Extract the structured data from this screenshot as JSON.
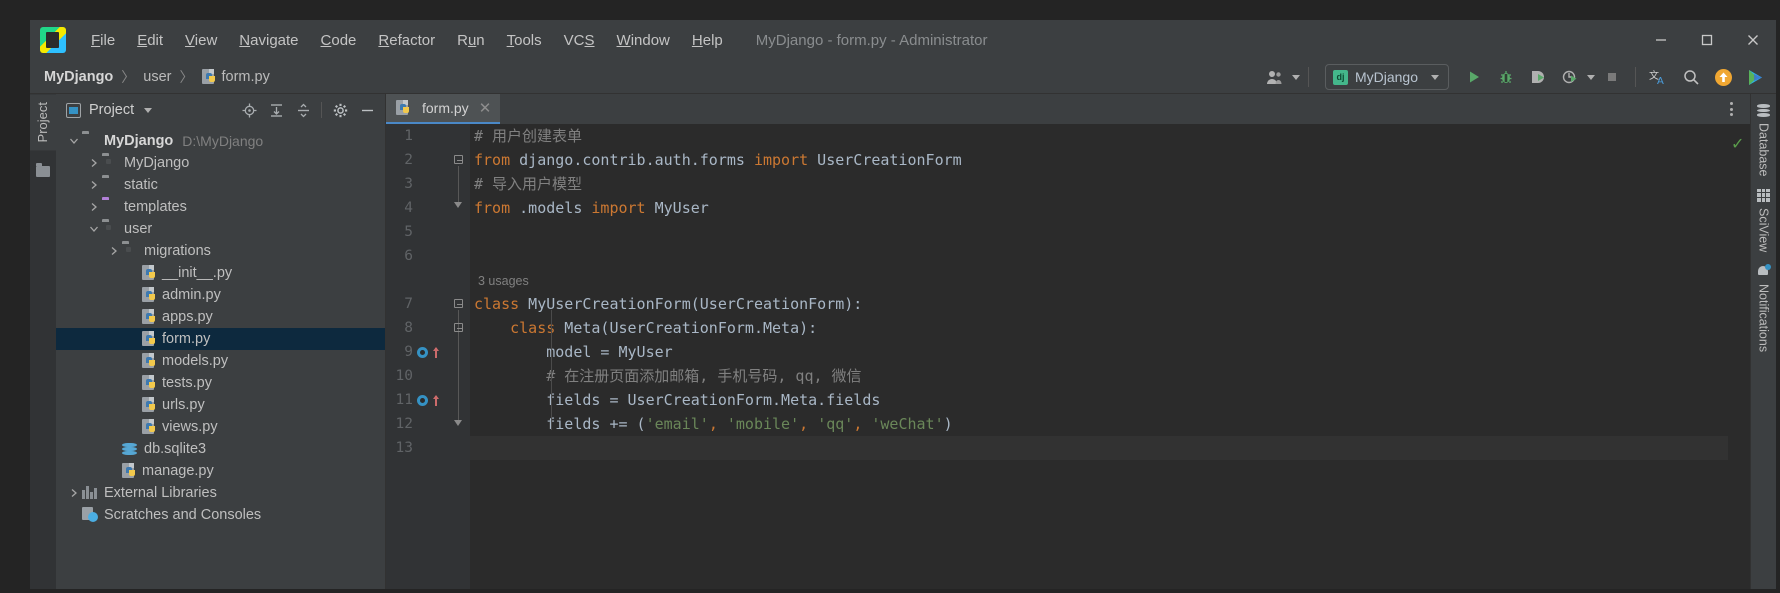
{
  "window": {
    "title": "MyDjango - form.py - Administrator",
    "minimize_icon": "minimize-icon",
    "maximize_icon": "maximize-icon",
    "close_icon": "close-icon"
  },
  "menubar": {
    "logo_label": "PC",
    "items": [
      {
        "label": "File",
        "mnemonic": "F"
      },
      {
        "label": "Edit",
        "mnemonic": "E"
      },
      {
        "label": "View",
        "mnemonic": "V"
      },
      {
        "label": "Navigate",
        "mnemonic": "N"
      },
      {
        "label": "Code",
        "mnemonic": "C"
      },
      {
        "label": "Refactor",
        "mnemonic": "R"
      },
      {
        "label": "Run",
        "mnemonic": "u"
      },
      {
        "label": "Tools",
        "mnemonic": "T"
      },
      {
        "label": "VCS",
        "mnemonic": "S"
      },
      {
        "label": "Window",
        "mnemonic": "W"
      },
      {
        "label": "Help",
        "mnemonic": "H"
      }
    ]
  },
  "breadcrumb": {
    "items": [
      "MyDjango",
      "user",
      "form.py"
    ],
    "separator": "〉",
    "file_icon": "python-file-icon"
  },
  "toolbar": {
    "account_icon": "user-account-icon",
    "run_config_name": "MyDjango",
    "run_config_icon": "django-icon",
    "run_icon": "run-icon",
    "debug_icon": "debug-icon",
    "coverage_icon": "run-with-coverage-icon",
    "profile_icon": "profiler-icon",
    "stop_icon": "stop-icon",
    "translate_icon": "translate-icon",
    "search_icon": "search-icon",
    "update_icon": "update-project-icon",
    "plugin_icon": "plugin-icon"
  },
  "project_panel": {
    "title": "Project",
    "vertical_tab": "Project",
    "locate_icon": "locate-in-tree-icon",
    "expand_icon": "expand-all-icon",
    "collapse_icon": "collapse-all-icon",
    "settings_icon": "gear-icon",
    "hide_icon": "hide-panel-icon",
    "tree": [
      {
        "label": "MyDjango",
        "path": "D:\\MyDjango",
        "icon": "folder-icon",
        "indent": 0,
        "arrow": "down",
        "bold": true,
        "selected": false
      },
      {
        "label": "MyDjango",
        "path": "",
        "icon": "module-folder-icon",
        "indent": 1,
        "arrow": "right",
        "bold": false,
        "selected": false
      },
      {
        "label": "static",
        "path": "",
        "icon": "folder-icon",
        "indent": 1,
        "arrow": "right",
        "bold": false,
        "selected": false
      },
      {
        "label": "templates",
        "path": "",
        "icon": "templates-folder-icon",
        "indent": 1,
        "arrow": "right",
        "bold": false,
        "selected": false
      },
      {
        "label": "user",
        "path": "",
        "icon": "module-folder-icon",
        "indent": 1,
        "arrow": "down",
        "bold": false,
        "selected": false
      },
      {
        "label": "migrations",
        "path": "",
        "icon": "module-folder-icon",
        "indent": 2,
        "arrow": "right",
        "bold": false,
        "selected": false
      },
      {
        "label": "__init__.py",
        "path": "",
        "icon": "python-file-icon",
        "indent": 3,
        "arrow": "none",
        "bold": false,
        "selected": false
      },
      {
        "label": "admin.py",
        "path": "",
        "icon": "python-file-icon",
        "indent": 3,
        "arrow": "none",
        "bold": false,
        "selected": false
      },
      {
        "label": "apps.py",
        "path": "",
        "icon": "python-file-icon",
        "indent": 3,
        "arrow": "none",
        "bold": false,
        "selected": false
      },
      {
        "label": "form.py",
        "path": "",
        "icon": "python-file-icon",
        "indent": 3,
        "arrow": "none",
        "bold": false,
        "selected": true
      },
      {
        "label": "models.py",
        "path": "",
        "icon": "python-file-icon",
        "indent": 3,
        "arrow": "none",
        "bold": false,
        "selected": false
      },
      {
        "label": "tests.py",
        "path": "",
        "icon": "python-file-icon",
        "indent": 3,
        "arrow": "none",
        "bold": false,
        "selected": false
      },
      {
        "label": "urls.py",
        "path": "",
        "icon": "python-file-icon",
        "indent": 3,
        "arrow": "none",
        "bold": false,
        "selected": false
      },
      {
        "label": "views.py",
        "path": "",
        "icon": "python-file-icon",
        "indent": 3,
        "arrow": "none",
        "bold": false,
        "selected": false
      },
      {
        "label": "db.sqlite3",
        "path": "",
        "icon": "database-file-icon",
        "indent": 2,
        "arrow": "none",
        "bold": false,
        "selected": false
      },
      {
        "label": "manage.py",
        "path": "",
        "icon": "python-file-icon",
        "indent": 2,
        "arrow": "none",
        "bold": false,
        "selected": false
      },
      {
        "label": "External Libraries",
        "path": "",
        "icon": "libraries-icon",
        "indent": 0,
        "arrow": "right",
        "bold": false,
        "selected": false
      },
      {
        "label": "Scratches and Consoles",
        "path": "",
        "icon": "scratches-icon",
        "indent": 0,
        "arrow": "none",
        "bold": false,
        "selected": false
      }
    ]
  },
  "editor": {
    "tab": {
      "label": "form.py",
      "icon": "python-file-icon",
      "close_icon": "close-icon"
    },
    "options_icon": "more-options-icon",
    "inspection_status": "ok-check-icon",
    "usage_hint": "3 usages",
    "lines": [
      {
        "no": "1",
        "tokens": [
          {
            "t": "# 用户创建表单",
            "c": "cm"
          }
        ],
        "indent": 0
      },
      {
        "no": "2",
        "tokens": [
          {
            "t": "from",
            "c": "kw"
          },
          {
            "t": " django.contrib.auth.forms ",
            "c": "cls"
          },
          {
            "t": "import",
            "c": "kw"
          },
          {
            "t": " UserCreationForm",
            "c": "cls"
          }
        ],
        "indent": 0
      },
      {
        "no": "3",
        "tokens": [
          {
            "t": "# 导入用户模型",
            "c": "cm"
          }
        ],
        "indent": 0
      },
      {
        "no": "4",
        "tokens": [
          {
            "t": "from",
            "c": "kw"
          },
          {
            "t": " .models ",
            "c": "cls"
          },
          {
            "t": "import",
            "c": "kw"
          },
          {
            "t": " MyUser",
            "c": "cls"
          }
        ],
        "indent": 0
      },
      {
        "no": "5",
        "tokens": [],
        "indent": 0
      },
      {
        "no": "6",
        "tokens": [],
        "indent": 0
      },
      {
        "no": "7",
        "tokens": [
          {
            "t": "class",
            "c": "kw"
          },
          {
            "t": " MyUserCreationForm(UserCreationForm):",
            "c": "cls"
          }
        ],
        "indent": 0
      },
      {
        "no": "8",
        "tokens": [
          {
            "t": "    ",
            "c": "cls"
          },
          {
            "t": "class",
            "c": "kw"
          },
          {
            "t": " Meta(UserCreationForm.Meta):",
            "c": "cls"
          }
        ],
        "indent": 1
      },
      {
        "no": "9",
        "tokens": [
          {
            "t": "        model = MyUser",
            "c": "cls"
          }
        ],
        "indent": 2
      },
      {
        "no": "10",
        "tokens": [
          {
            "t": "        # 在注册页面添加邮箱, 手机号码, qq, 微信",
            "c": "cm"
          }
        ],
        "indent": 2
      },
      {
        "no": "11",
        "tokens": [
          {
            "t": "        fields = UserCreationForm.Meta.fields",
            "c": "cls"
          }
        ],
        "indent": 2
      },
      {
        "no": "12",
        "tokens": [
          {
            "t": "        fields += (",
            "c": "cls"
          },
          {
            "t": "'email'",
            "c": "str"
          },
          {
            "t": ",",
            "c": "punc"
          },
          {
            "t": " ",
            "c": "cls"
          },
          {
            "t": "'mobile'",
            "c": "str"
          },
          {
            "t": ",",
            "c": "punc"
          },
          {
            "t": " ",
            "c": "cls"
          },
          {
            "t": "'qq'",
            "c": "str"
          },
          {
            "t": ",",
            "c": "punc"
          },
          {
            "t": " ",
            "c": "cls"
          },
          {
            "t": "'weChat'",
            "c": "str"
          },
          {
            "t": ")",
            "c": "cls"
          }
        ],
        "indent": 2
      },
      {
        "no": "13",
        "tokens": [],
        "indent": 0
      }
    ],
    "breakpoint_lines": [
      "9",
      "11"
    ]
  },
  "right_strip": {
    "tabs": [
      {
        "label": "Database",
        "icon": "database-icon"
      },
      {
        "label": "SciView",
        "icon": "grid-icon"
      },
      {
        "label": "Notifications",
        "icon": "bell-icon"
      }
    ]
  },
  "colors": {
    "accent": "#4a88c7",
    "selection": "#0d293e",
    "keyword": "#cc7832",
    "string": "#6a8759",
    "comment": "#808080",
    "text": "#a9b7c6",
    "panel": "#3c3f41",
    "editor_bg": "#2b2b2b",
    "run_green": "#59a869"
  }
}
